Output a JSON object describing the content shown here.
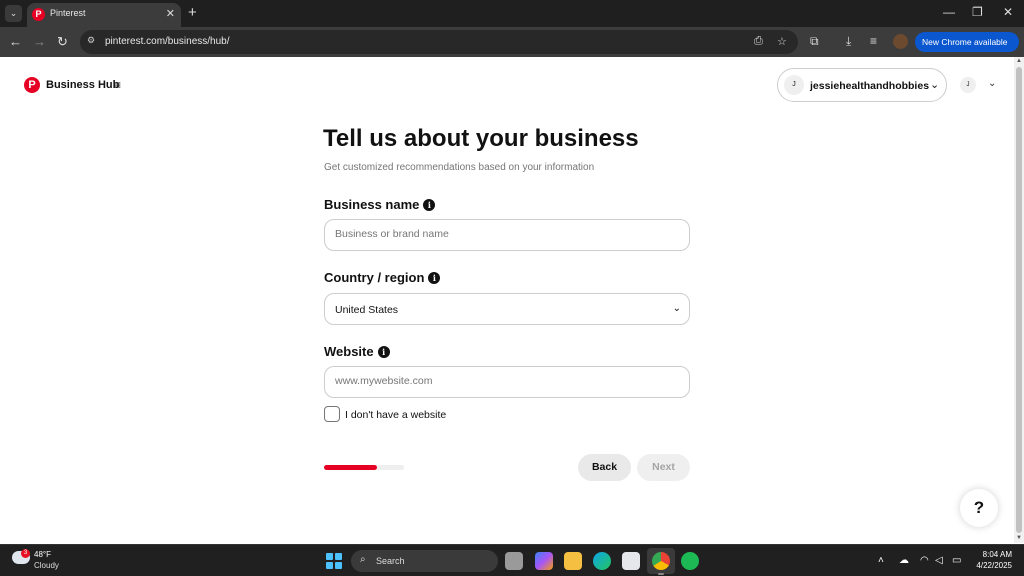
{
  "browser": {
    "tab_title": "Pinterest",
    "tab_favicon": "P",
    "new_tab_icon": "+",
    "url": "pinterest.com/business/hub/",
    "update_button": "New Chrome available",
    "window_controls": [
      "minimize-icon",
      "restore-icon",
      "close-icon"
    ]
  },
  "header": {
    "logo_letter": "P",
    "title": "Business Hub",
    "menu_icon": "≡",
    "account_initial": "J",
    "account_name": "jessiehealthandhobbies",
    "user_initial": "J"
  },
  "form": {
    "heading": "Tell us about your business",
    "subheading": "Get customized recommendations based on your information",
    "info_glyph": "i",
    "business_name": {
      "label": "Business name",
      "placeholder": "Business or brand name",
      "value": ""
    },
    "country": {
      "label": "Country / region",
      "value": "United States"
    },
    "website": {
      "label": "Website",
      "placeholder": "www.mywebsite.com",
      "value": ""
    },
    "no_website_label": "I don't have a website",
    "no_website_checked": false,
    "progress_fraction": 0.66,
    "back_label": "Back",
    "next_label": "Next",
    "help_label": "?"
  },
  "taskbar": {
    "temperature": "48°F",
    "condition": "Cloudy",
    "weather_badge": "3",
    "search_label": "Search",
    "time": "8:04 AM",
    "date": "4/22/2025"
  },
  "colors": {
    "brand": "#e60023",
    "chrome_dark": "#1f1f1f",
    "update_blue": "#0b57d0"
  }
}
